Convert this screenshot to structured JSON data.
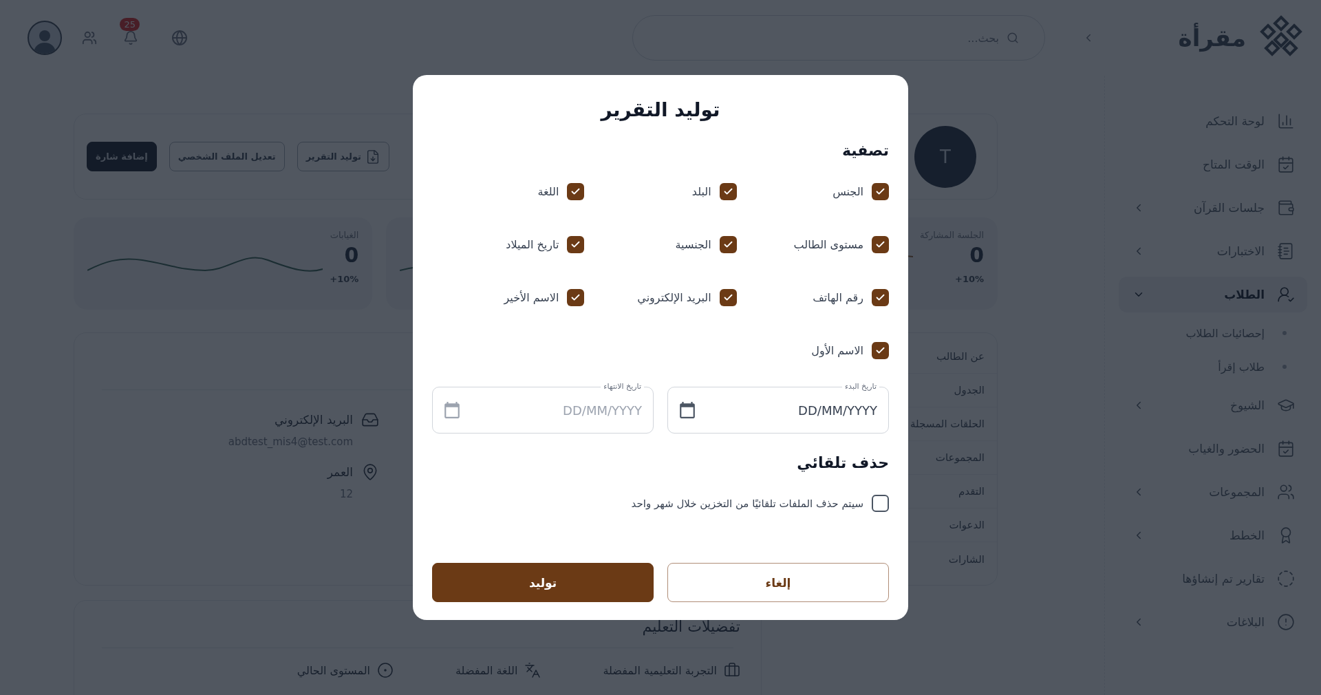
{
  "header": {
    "logo_text": "مقرأة",
    "search": {
      "placeholder": "بحث..."
    },
    "notifications": {
      "count": "25"
    }
  },
  "sidebar": {
    "items": [
      {
        "label": "لوحة التحكم",
        "selected": false
      },
      {
        "label": "الوقت المتاح",
        "selected": false
      },
      {
        "label": "جلسات القرآن",
        "expanded": false,
        "selected": false
      },
      {
        "label": "الاختبارات",
        "expanded": false,
        "selected": false
      },
      {
        "label": "الطلاب",
        "expanded": true,
        "selected": true,
        "children": [
          {
            "label": "إحصائيات الطلاب"
          },
          {
            "label": "طلاب إقرأ"
          }
        ]
      },
      {
        "label": "الشيوخ",
        "expanded": false,
        "selected": false
      },
      {
        "label": "الحضور والغياب",
        "selected": false
      },
      {
        "label": "المجموعات",
        "expanded": false,
        "selected": false
      },
      {
        "label": "الخطط",
        "expanded": false,
        "selected": false
      },
      {
        "label": "تقارير تم إنشاؤها",
        "selected": false
      },
      {
        "label": "البلاغات",
        "expanded": false,
        "selected": false
      }
    ]
  },
  "profile": {
    "avatar_letter": "T",
    "actions": [
      {
        "label": "توليد التقرير",
        "kind": "outline-icon"
      },
      {
        "label": "تعديل الملف الشخصي",
        "kind": "outline"
      },
      {
        "label": "إضافة شارة",
        "kind": "dark"
      }
    ]
  },
  "stats": [
    {
      "title": "الجلسة المشاركة",
      "value": "0",
      "change": "10%+"
    },
    {
      "title": "الغيابات",
      "value": "0",
      "change": "10%+"
    }
  ],
  "profile_tabs": [
    {
      "label": "عن الطالب"
    },
    {
      "label": "الجدول"
    },
    {
      "label": "الحلقات المسجلة"
    },
    {
      "label": "المجموعات"
    },
    {
      "label": "التقدم"
    },
    {
      "label": "الدعوات"
    },
    {
      "label": "الشارات"
    }
  ],
  "contact": [
    {
      "label": "البريد الإلكتروني",
      "value": "abdtest_mis4@test.com"
    },
    {
      "label": "العمر",
      "value": "12"
    }
  ],
  "education": {
    "title": "تفضيلات التعليم",
    "items": [
      {
        "label": "التجربة التعليمية المفضلة"
      },
      {
        "label": "اللغة المفضلة"
      },
      {
        "label": "المستوى الحالي"
      }
    ]
  },
  "dialog": {
    "title": "توليد التقرير",
    "filter_title": "تصفية",
    "filters": [
      {
        "label": "الجنس",
        "checked": true
      },
      {
        "label": "البلد",
        "checked": true
      },
      {
        "label": "اللغة",
        "checked": true
      },
      {
        "label": "مستوى الطالب",
        "checked": true
      },
      {
        "label": "الجنسية",
        "checked": true
      },
      {
        "label": "تاريخ الميلاد",
        "checked": true
      },
      {
        "label": "رقم الهاتف",
        "checked": true
      },
      {
        "label": "البريد الإلكتروني",
        "checked": true
      },
      {
        "label": "الاسم الأخير",
        "checked": true
      },
      {
        "label": "الاسم الأول",
        "checked": true
      }
    ],
    "dates": [
      {
        "label": "تاريخ البدء",
        "value": "DD/MM/YYYY"
      },
      {
        "label": "تاريخ الانتهاء",
        "placeholder": "DD/MM/YYYY"
      }
    ],
    "auto_delete": {
      "title": "حذف تلقائي",
      "label": "سيتم حذف الملفات تلقائيًا من التخزين خلال شهر واحد",
      "checked": false
    },
    "buttons": [
      {
        "label": "إلغاء",
        "kind": "secondary"
      },
      {
        "label": "توليد",
        "kind": "primary"
      }
    ]
  }
}
